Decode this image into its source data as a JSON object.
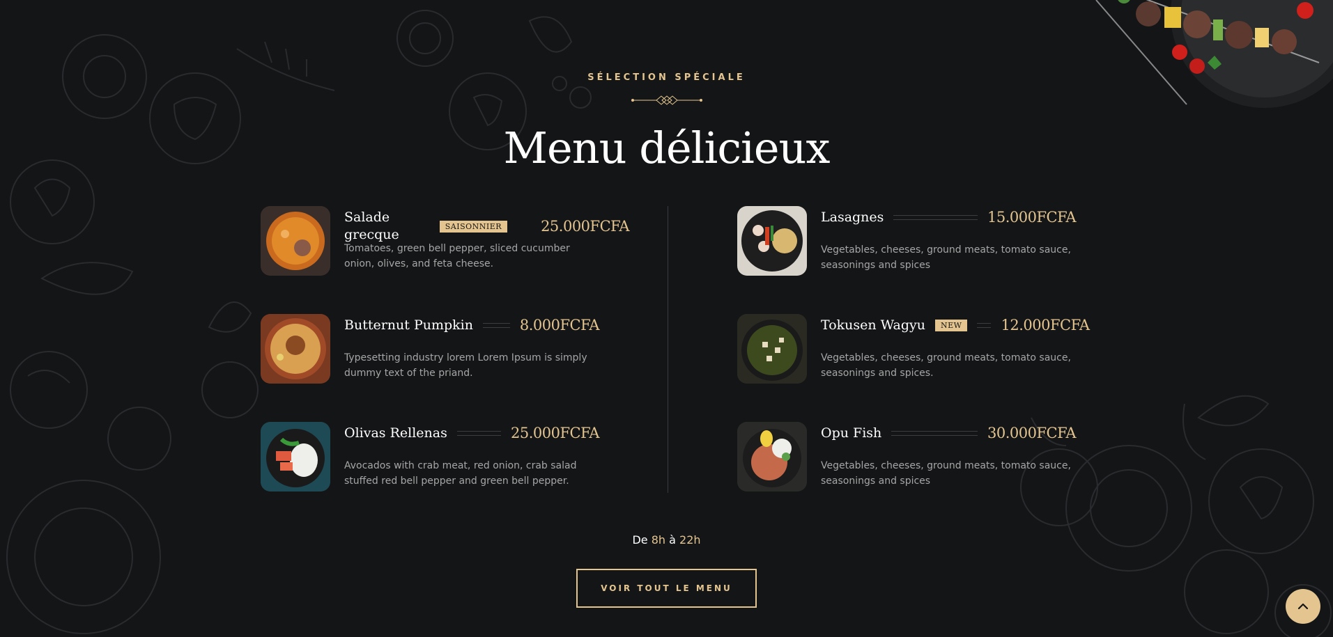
{
  "section": {
    "subtitle": "SÉLECTION SPÉCIALE",
    "title": "Menu délicieux"
  },
  "menu": {
    "left": [
      {
        "name": "Salade grecque",
        "badge": "SAISONNIER",
        "price": "25.000FCFA",
        "description": "Tomatoes, green bell pepper, sliced cucumber onion, olives, and feta cheese."
      },
      {
        "name": "Butternut Pumpkin",
        "badge": "",
        "price": "8.000FCFA",
        "description": "Typesetting industry lorem Lorem Ipsum is simply dummy text of the priand."
      },
      {
        "name": "Olivas Rellenas",
        "badge": "",
        "price": "25.000FCFA",
        "description": "Avocados with crab meat, red onion, crab salad stuffed red bell pepper and green bell pepper."
      }
    ],
    "right": [
      {
        "name": "Lasagnes",
        "badge": "",
        "price": "15.000FCFA",
        "description": "Vegetables, cheeses, ground meats, tomato sauce, seasonings and spices"
      },
      {
        "name": "Tokusen Wagyu",
        "badge": "NEW",
        "price": "12.000FCFA",
        "description": "Vegetables, cheeses, ground meats, tomato sauce, seasonings and spices."
      },
      {
        "name": "Opu Fish",
        "badge": "",
        "price": "30.000FCFA",
        "description": "Vegetables, cheeses, ground meats, tomato sauce, seasonings and spices"
      }
    ]
  },
  "hours": {
    "prefix": "De",
    "open": "8h",
    "sep": "à",
    "close": "22h"
  },
  "cta": {
    "label": "VOIR TOUT LE MENU"
  },
  "icons": {
    "scroll_top": "chevron-up-icon",
    "separator": "diamond-ornament-icon"
  },
  "colors": {
    "accent": "#e4c590",
    "background": "#141517"
  }
}
